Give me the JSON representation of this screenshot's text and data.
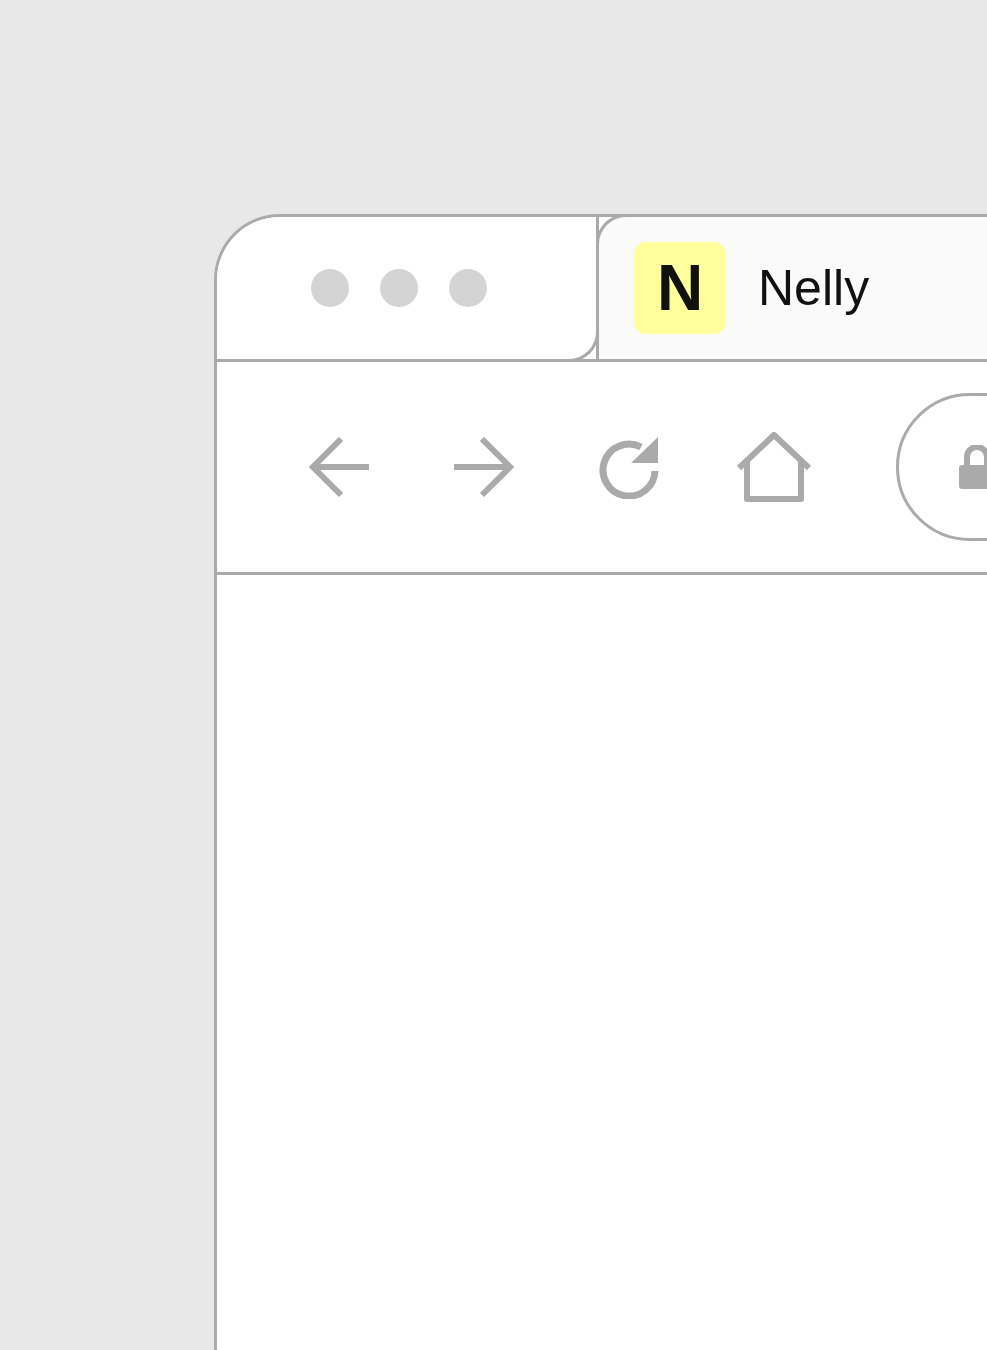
{
  "tabs": [
    {
      "title": "Nelly",
      "favicon": "N"
    }
  ]
}
